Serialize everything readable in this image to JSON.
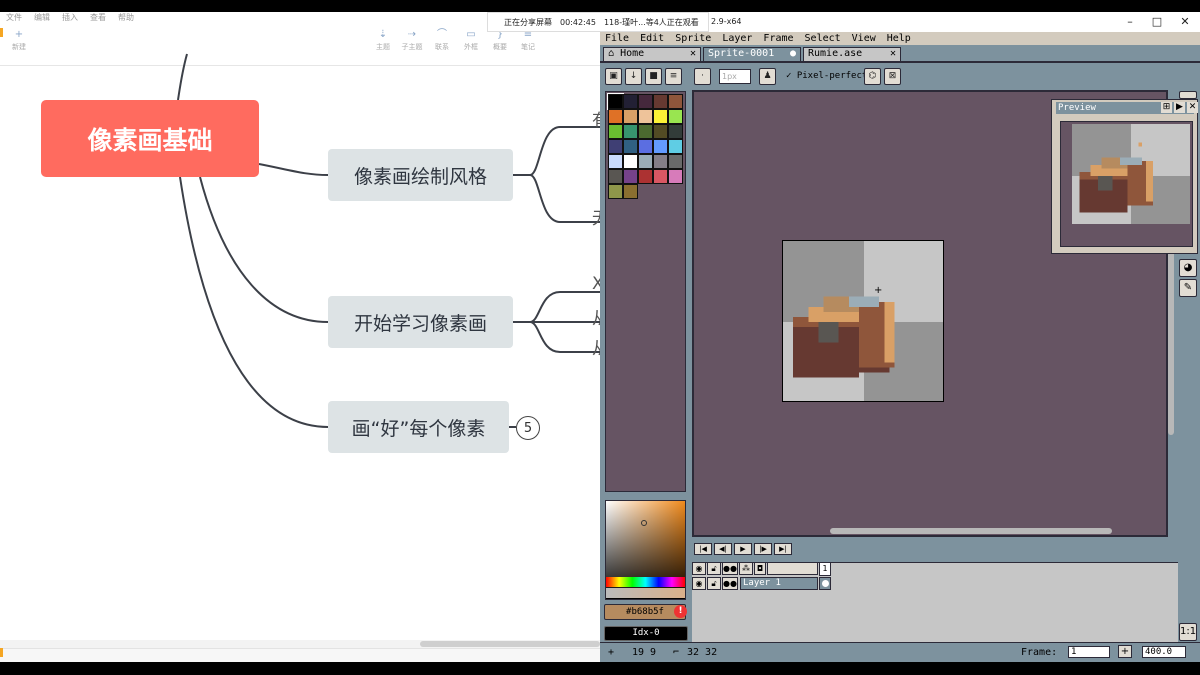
{
  "mindmap": {
    "menu": [
      "文件",
      "编辑",
      "插入",
      "查看",
      "帮助"
    ],
    "new_label": "新建",
    "tools": [
      {
        "label": "主题",
        "icon": "topic-icon"
      },
      {
        "label": "子主题",
        "icon": "subtopic-icon"
      },
      {
        "label": "联系",
        "icon": "relation-icon"
      },
      {
        "label": "外框",
        "icon": "boundary-icon"
      },
      {
        "label": "概要",
        "icon": "summary-icon"
      },
      {
        "label": "笔记",
        "icon": "note-icon"
      }
    ],
    "root": "像素画基础",
    "branches": [
      "像素画绘制风格",
      "开始学习像素画",
      "画“好”每个像素"
    ],
    "collapsed_count": "5",
    "peek_chars": [
      "有",
      "无",
      "X",
      "从",
      "从"
    ]
  },
  "share_banner": {
    "status": "正在分享屏幕",
    "time": "00:42:45",
    "viewers": "118-瑾叶...等4人正在观看"
  },
  "aseprite": {
    "title_fragment": "2.9-x64",
    "menu": [
      "File",
      "Edit",
      "Sprite",
      "Layer",
      "Frame",
      "Select",
      "View",
      "Help"
    ],
    "tabs": [
      {
        "label": "Home",
        "close": "✕"
      },
      {
        "label": "Sprite-0001",
        "close": "●"
      },
      {
        "label": "Rumie.ase",
        "close": "✕"
      }
    ],
    "brush_size": "1px",
    "pixel_perfect": "Pixel-perfect",
    "palette": [
      "#000000",
      "#222034",
      "#45283c",
      "#663931",
      "#8f563b",
      "#df7126",
      "#d9a066",
      "#eec39a",
      "#fbf236",
      "#99e550",
      "#6abe30",
      "#37946e",
      "#4b692f",
      "#524b24",
      "#323c39",
      "#3f3f74",
      "#306082",
      "#5b6ee1",
      "#639bff",
      "#5fcde4",
      "#cbdbfc",
      "#ffffff",
      "#9badb7",
      "#847e87",
      "#696a6a",
      "#595652",
      "#76428a",
      "#ac3232",
      "#d95763",
      "#d77bba",
      "#8f974a",
      "#8a6f30"
    ],
    "hex_color": "#b68b5f",
    "index": "Idx-0",
    "preview_title": "Preview",
    "layer_name": "Layer 1",
    "frame_number": "1",
    "status": {
      "cursor": "19 9",
      "size": "32 32",
      "frame_label": "Frame:",
      "frame_value": "1",
      "zoom": "400.0"
    },
    "colors": {
      "ui_bg": "#7d929e",
      "canvas_bg": "#665463",
      "menu_bg": "#d3cbbe"
    }
  }
}
